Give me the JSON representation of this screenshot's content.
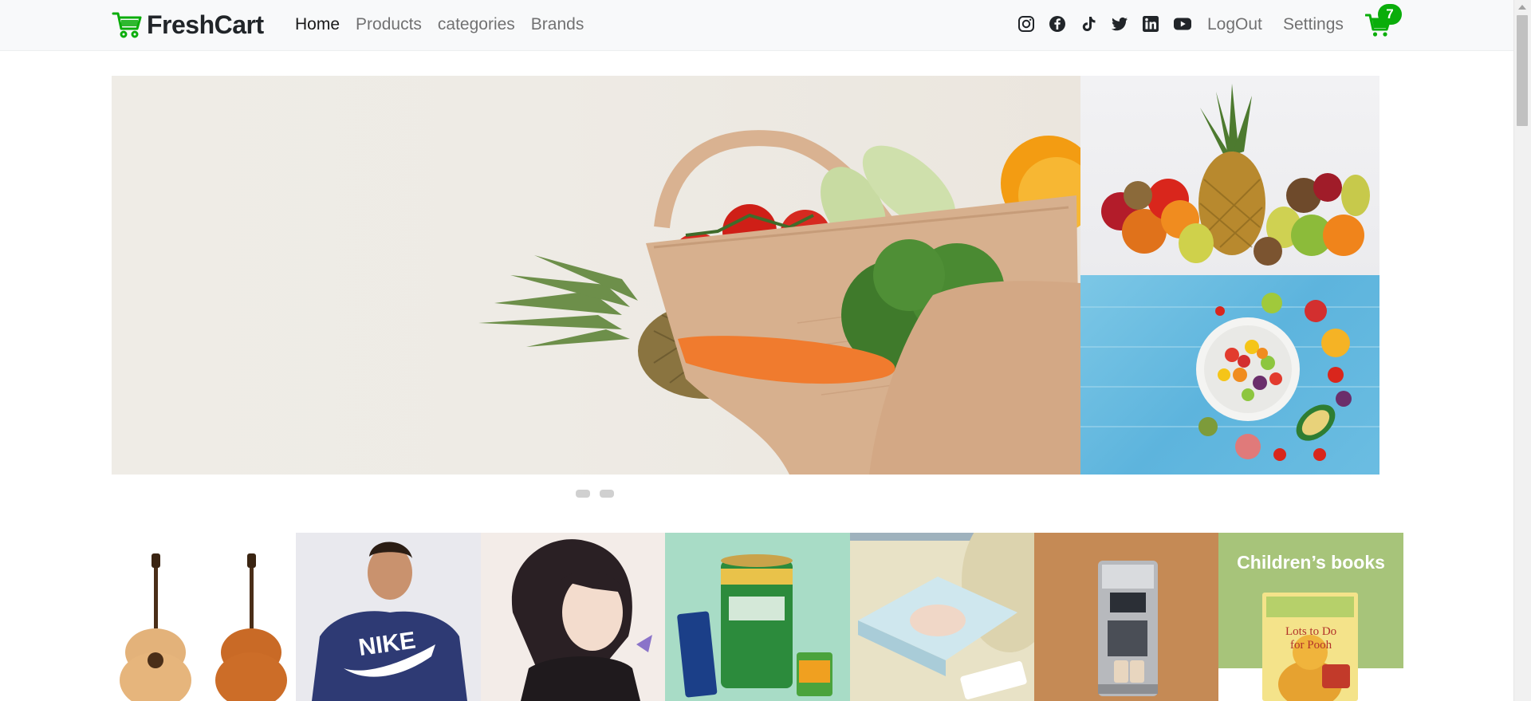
{
  "brand": {
    "name": "FreshCart"
  },
  "nav": {
    "links": [
      {
        "label": "Home",
        "active": true
      },
      {
        "label": "Products",
        "active": false
      },
      {
        "label": "categories",
        "active": false
      },
      {
        "label": "Brands",
        "active": false
      }
    ],
    "social_icons": [
      "instagram-icon",
      "facebook-icon",
      "tiktok-icon",
      "twitter-icon",
      "linkedin-icon",
      "youtube-icon"
    ],
    "logout_label": "LogOut",
    "settings_label": "Settings",
    "cart_count": "7"
  },
  "hero": {
    "slides_count": 2,
    "main_image": "shopping-bag-vegetables",
    "side_images": [
      "fruit-pile",
      "fruit-salad-bowl"
    ]
  },
  "categories": [
    {
      "image": "guitars"
    },
    {
      "image": "nike-hoodie-man"
    },
    {
      "image": "illustrated-woman"
    },
    {
      "image": "grocery-products"
    },
    {
      "image": "baby-diapers"
    },
    {
      "image": "coffee-machine"
    },
    {
      "image": "childrens-book",
      "label": "Children’s books"
    }
  ],
  "colors": {
    "accent": "#0aad0a",
    "navbar_bg": "#f8f9fa"
  }
}
